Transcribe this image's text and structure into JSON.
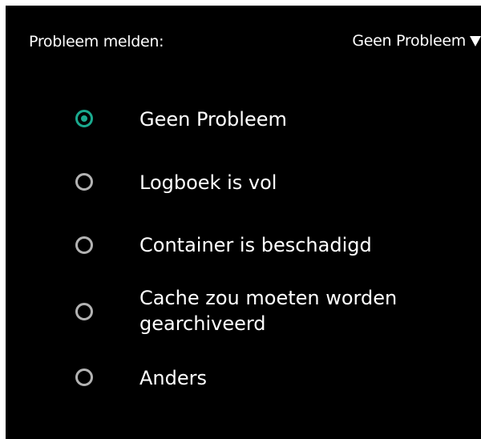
{
  "header": {
    "label": "Probleem melden:",
    "dropdown_value": "Geen Probleem"
  },
  "colors": {
    "background": "#000000",
    "text": "#ffffff",
    "accent": "#1aaa8f",
    "radio_unchecked": "#b3b3b3"
  },
  "options": [
    {
      "label": "Geen Probleem",
      "checked": true
    },
    {
      "label": "Logboek is vol",
      "checked": false
    },
    {
      "label": "Container is beschadigd",
      "checked": false
    },
    {
      "label": "Cache zou moeten worden gearchiveerd",
      "checked": false
    },
    {
      "label": "Anders",
      "checked": false
    }
  ]
}
